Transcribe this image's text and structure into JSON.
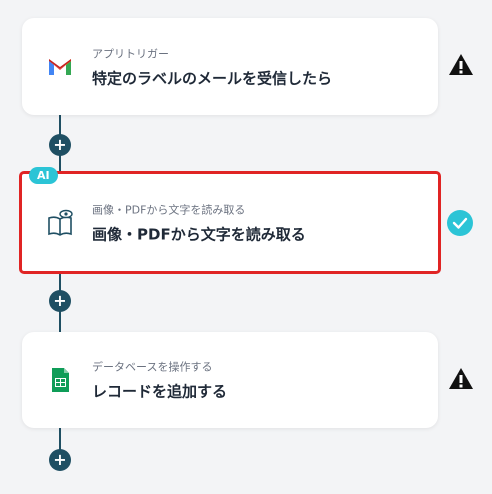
{
  "steps": [
    {
      "subtitle": "アプリトリガー",
      "title": "特定のラベルのメールを受信したら",
      "icon": "gmail-icon",
      "status": "warning"
    },
    {
      "badge": "AI",
      "subtitle": "画像・PDFから文字を読み取る",
      "title": "画像・PDFから文字を読み取る",
      "icon": "book-ocr-icon",
      "status": "done",
      "selected": true
    },
    {
      "subtitle": "データベースを操作する",
      "title": "レコードを追加する",
      "icon": "google-sheets-icon",
      "status": "warning"
    }
  ],
  "add_label": "+",
  "colors": {
    "connector": "#1f4f63",
    "check": "#2bc4d6",
    "selected_border": "#e02424",
    "warning": "#111111"
  }
}
